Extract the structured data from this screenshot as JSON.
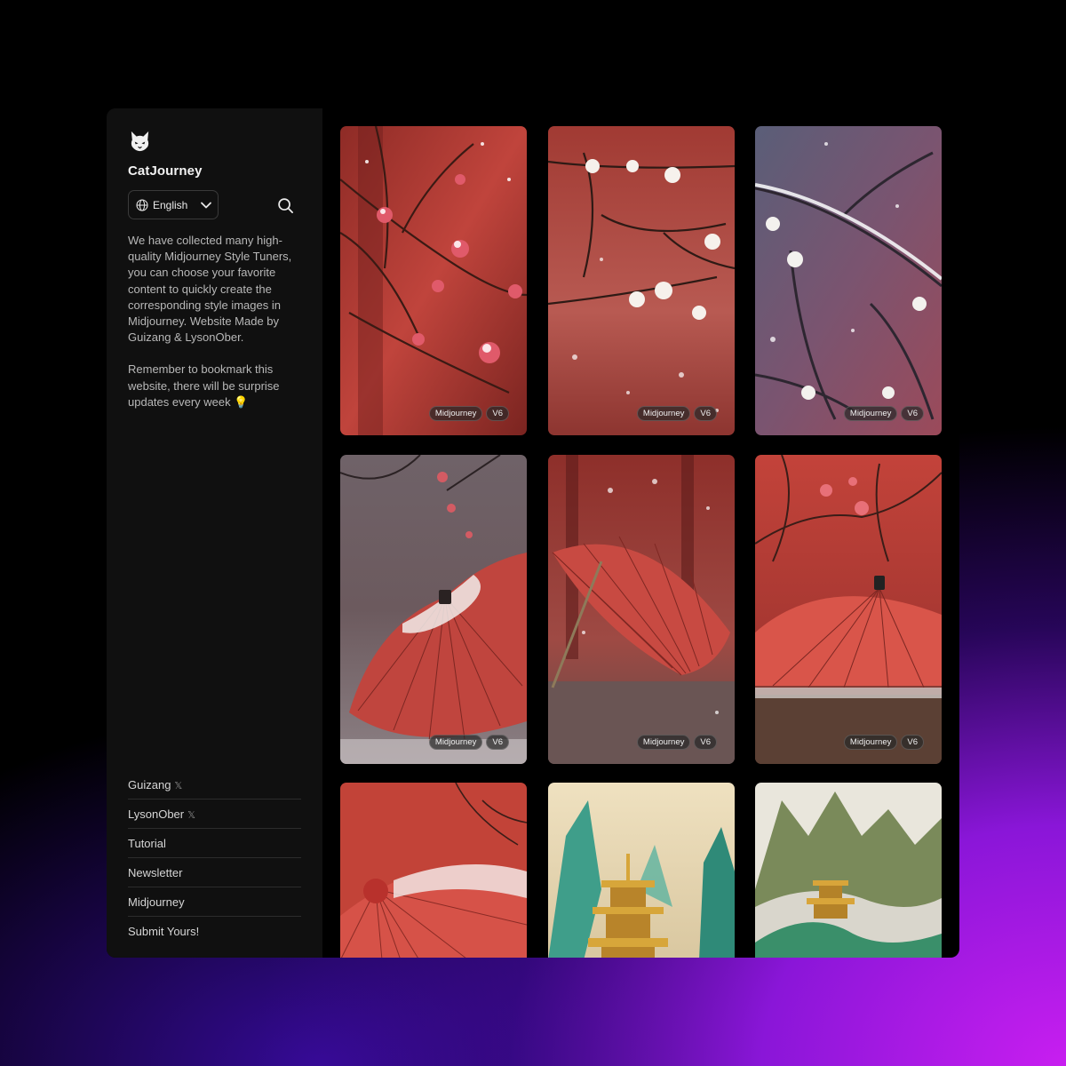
{
  "brand": {
    "name": "CatJourney",
    "logo_icon": "cat-head-icon"
  },
  "language": {
    "selected": "English",
    "icon": "globe-icon"
  },
  "search": {
    "icon": "search-icon"
  },
  "description": {
    "p1": "We have collected many high-quality Midjourney Style Tuners, you can choose your favorite content to quickly create the corresponding style images in Midjourney. Website Made by Guizang & LysonOber.",
    "p2": "Remember to bookmark this website, there will be surprise updates every week 💡"
  },
  "footer_links": [
    {
      "label": "Guizang",
      "suffix": "𝕏"
    },
    {
      "label": "LysonOber",
      "suffix": "𝕏"
    },
    {
      "label": "Tutorial",
      "suffix": ""
    },
    {
      "label": "Newsletter",
      "suffix": ""
    },
    {
      "label": "Midjourney",
      "suffix": ""
    },
    {
      "label": "Submit Yours!",
      "suffix": ""
    }
  ],
  "gallery": {
    "cards": [
      {
        "subject": "red plum blossom branch in snow",
        "tag1": "Midjourney",
        "tag2": "V6"
      },
      {
        "subject": "white plum blossom branch in snow",
        "tag1": "Midjourney",
        "tag2": "V6"
      },
      {
        "subject": "snowy branch with white blossoms",
        "tag1": "Midjourney",
        "tag2": "V6"
      },
      {
        "subject": "red paper umbrella in snow",
        "tag1": "Midjourney",
        "tag2": "V6"
      },
      {
        "subject": "red paper umbrella on snowy ground",
        "tag1": "Midjourney",
        "tag2": "V6"
      },
      {
        "subject": "red umbrella under blossom branch",
        "tag1": "Midjourney",
        "tag2": "V6"
      },
      {
        "subject": "red umbrella close-up",
        "tag1": "",
        "tag2": ""
      },
      {
        "subject": "golden pagoda among jade mountains",
        "tag1": "",
        "tag2": ""
      },
      {
        "subject": "golden temple on green mountains",
        "tag1": "",
        "tag2": ""
      }
    ]
  },
  "colors": {
    "accent": "#c81ef0",
    "panel": "#101010",
    "background": "#000000"
  }
}
